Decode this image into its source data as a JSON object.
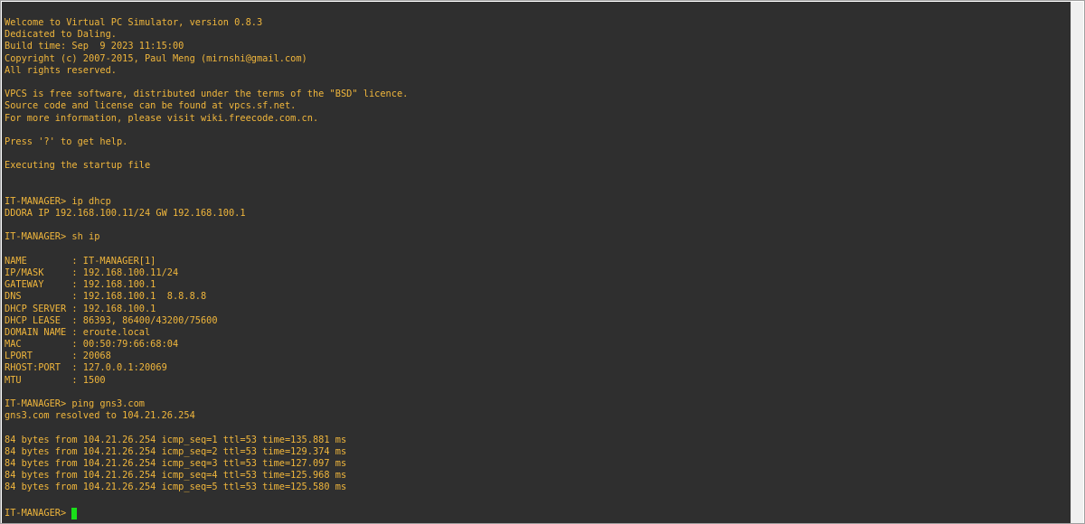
{
  "terminal": {
    "lines": [
      "Welcome to Virtual PC Simulator, version 0.8.3",
      "Dedicated to Daling.",
      "Build time: Sep  9 2023 11:15:00",
      "Copyright (c) 2007-2015, Paul Meng (mirnshi@gmail.com)",
      "All rights reserved.",
      "",
      "VPCS is free software, distributed under the terms of the \"BSD\" licence.",
      "Source code and license can be found at vpcs.sf.net.",
      "For more information, please visit wiki.freecode.com.cn.",
      "",
      "Press '?' to get help.",
      "",
      "Executing the startup file",
      "",
      "",
      "IT-MANAGER> ip dhcp",
      "DDORA IP 192.168.100.11/24 GW 192.168.100.1",
      "",
      "IT-MANAGER> sh ip",
      "",
      "NAME        : IT-MANAGER[1]",
      "IP/MASK     : 192.168.100.11/24",
      "GATEWAY     : 192.168.100.1",
      "DNS         : 192.168.100.1  8.8.8.8",
      "DHCP SERVER : 192.168.100.1",
      "DHCP LEASE  : 86393, 86400/43200/75600",
      "DOMAIN NAME : eroute.local",
      "MAC         : 00:50:79:66:68:04",
      "LPORT       : 20068",
      "RHOST:PORT  : 127.0.0.1:20069",
      "MTU         : 1500",
      "",
      "IT-MANAGER> ping gns3.com",
      "gns3.com resolved to 104.21.26.254",
      "",
      "84 bytes from 104.21.26.254 icmp_seq=1 ttl=53 time=135.881 ms",
      "84 bytes from 104.21.26.254 icmp_seq=2 ttl=53 time=129.374 ms",
      "84 bytes from 104.21.26.254 icmp_seq=3 ttl=53 time=127.097 ms",
      "84 bytes from 104.21.26.254 icmp_seq=4 ttl=53 time=125.968 ms",
      "84 bytes from 104.21.26.254 icmp_seq=5 ttl=53 time=125.580 ms"
    ],
    "prompt": "IT-MANAGER>",
    "colors": {
      "background": "#2f2f2f",
      "text": "#f0b63c",
      "cursor": "#19e019"
    }
  }
}
